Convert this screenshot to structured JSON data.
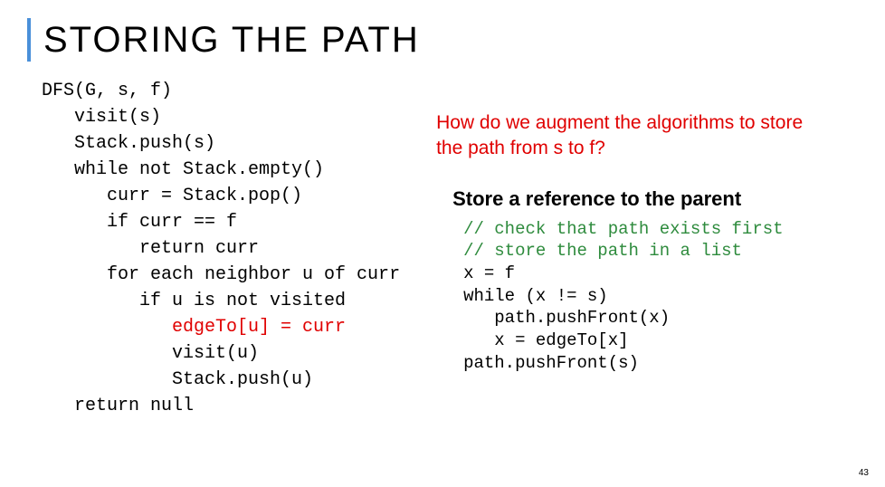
{
  "title": "STORING THE PATH",
  "pseudocode": {
    "l1": "DFS(G, s, f)",
    "l2": "   visit(s)",
    "l3": "   Stack.push(s)",
    "l4": "   while not Stack.empty()",
    "l5": "      curr = Stack.pop()",
    "l6": "      if curr == f",
    "l7": "         return curr",
    "l8": "      for each neighbor u of curr",
    "l9": "         if u is not visited",
    "l10": "            edgeTo[u] = curr",
    "l11": "            visit(u)",
    "l12": "            Stack.push(u)",
    "l13": "   return null"
  },
  "question": "How do we augment the algorithms to store the path from s to f?",
  "subtitle": "Store a reference to the parent",
  "right_code": {
    "c1": "// check that path exists first",
    "c2": "// store the path in a list",
    "l1": "x = f",
    "l2": "while (x != s)",
    "l3": "   path.pushFront(x)",
    "l4": "   x = edgeTo[x]",
    "l5": "path.pushFront(s)"
  },
  "page_number": "43"
}
